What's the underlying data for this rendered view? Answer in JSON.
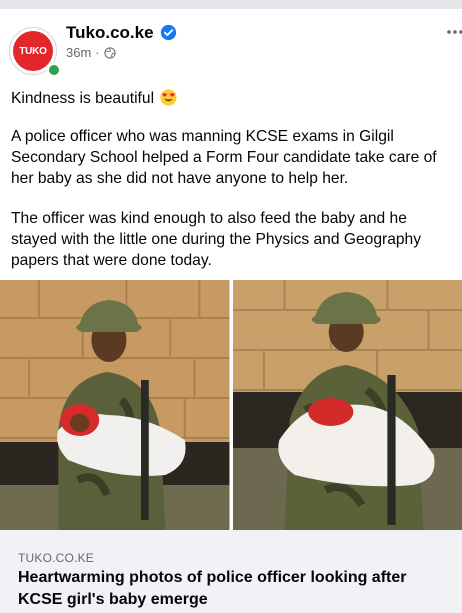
{
  "post": {
    "page_name": "Tuko.co.ke",
    "avatar_text": "TUKO",
    "time": "36m",
    "separator": "·",
    "text_line1": "Kindness is beautiful",
    "text_para1": "A police officer who was manning KCSE exams in Gilgil Secondary School helped a Form Four candidate take care of her baby as she did not have anyone to help her.",
    "text_para2": "The officer was kind enough to also feed the baby and he stayed with the little one during the Physics and Geography papers that were done today."
  },
  "link": {
    "domain": "TUKO.CO.KE",
    "headline": "Heartwarming photos of police officer looking after KCSE girl's baby emerge"
  },
  "icons": {
    "verified": "verified-badge-icon",
    "privacy": "globe-icon",
    "more": "more-options-icon",
    "emoji": "heart-eyes-emoji"
  },
  "colors": {
    "brand_red": "#e3262b",
    "verified_blue": "#1877f2",
    "online_green": "#31a24c",
    "secondary_text": "#65676b",
    "link_card_bg": "#f0f2f5"
  }
}
